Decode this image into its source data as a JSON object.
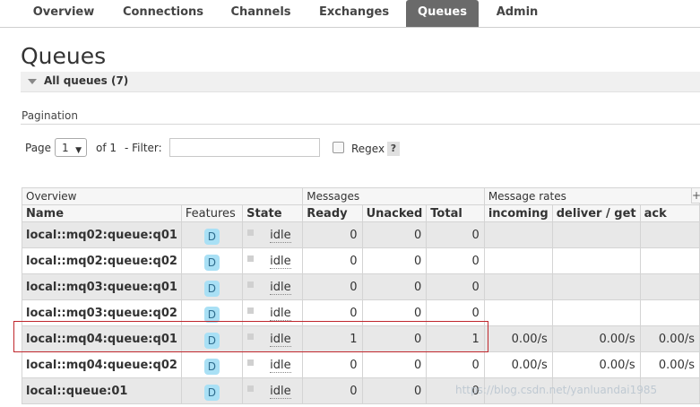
{
  "nav": {
    "items": [
      "Overview",
      "Connections",
      "Channels",
      "Exchanges",
      "Queues",
      "Admin"
    ],
    "active": "Queues"
  },
  "page_title": "Queues",
  "section": {
    "label": "All queues (7)"
  },
  "pagination": {
    "label": "Pagination",
    "page_label": "Page",
    "page_value": "1",
    "of_label": "of 1",
    "filter_label": "- Filter:",
    "filter_value": "",
    "regex_label": "Regex",
    "help_label": "?"
  },
  "table": {
    "groups": {
      "overview": "Overview",
      "messages": "Messages",
      "rates": "Message rates",
      "plus": "+/-"
    },
    "columns": [
      "Name",
      "Features",
      "State",
      "Ready",
      "Unacked",
      "Total",
      "incoming",
      "deliver / get",
      "ack"
    ],
    "rows": [
      {
        "name": "local::mq02:queue:q01",
        "feature": "D",
        "state": "idle",
        "ready": "0",
        "unacked": "0",
        "total": "0",
        "incoming": "",
        "deliver": "",
        "ack": ""
      },
      {
        "name": "local::mq02:queue:q02",
        "feature": "D",
        "state": "idle",
        "ready": "0",
        "unacked": "0",
        "total": "0",
        "incoming": "",
        "deliver": "",
        "ack": ""
      },
      {
        "name": "local::mq03:queue:q01",
        "feature": "D",
        "state": "idle",
        "ready": "0",
        "unacked": "0",
        "total": "0",
        "incoming": "",
        "deliver": "",
        "ack": ""
      },
      {
        "name": "local::mq03:queue:q02",
        "feature": "D",
        "state": "idle",
        "ready": "0",
        "unacked": "0",
        "total": "0",
        "incoming": "",
        "deliver": "",
        "ack": ""
      },
      {
        "name": "local::mq04:queue:q01",
        "feature": "D",
        "state": "idle",
        "ready": "1",
        "unacked": "0",
        "total": "1",
        "incoming": "0.00/s",
        "deliver": "0.00/s",
        "ack": "0.00/s"
      },
      {
        "name": "local::mq04:queue:q02",
        "feature": "D",
        "state": "idle",
        "ready": "0",
        "unacked": "0",
        "total": "0",
        "incoming": "0.00/s",
        "deliver": "0.00/s",
        "ack": "0.00/s"
      },
      {
        "name": "local::queue:01",
        "feature": "D",
        "state": "idle",
        "ready": "0",
        "unacked": "0",
        "total": "0",
        "incoming": "",
        "deliver": "",
        "ack": ""
      }
    ]
  },
  "watermark": "https://blog.csdn.net/yanluandai1985",
  "colors": {
    "nav_active": "#6a6a6a",
    "badge": "#a9e0f5",
    "highlight": "#c0272d"
  }
}
